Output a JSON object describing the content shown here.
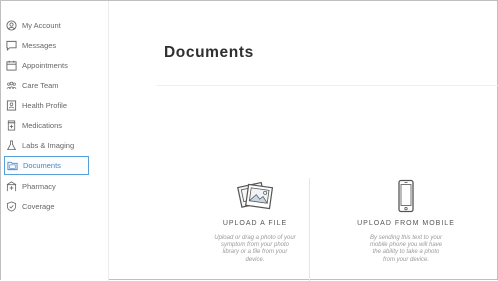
{
  "sidebar": {
    "items": [
      {
        "label": "My Account",
        "icon": "account-circle-icon"
      },
      {
        "label": "Messages",
        "icon": "message-icon"
      },
      {
        "label": "Appointments",
        "icon": "calendar-icon"
      },
      {
        "label": "Care Team",
        "icon": "team-icon"
      },
      {
        "label": "Health Profile",
        "icon": "profile-card-icon"
      },
      {
        "label": "Medications",
        "icon": "pill-bottle-icon"
      },
      {
        "label": "Labs & Imaging",
        "icon": "flask-icon"
      },
      {
        "label": "Documents",
        "icon": "folder-icon",
        "active": true
      },
      {
        "label": "Pharmacy",
        "icon": "pharmacy-icon"
      },
      {
        "label": "Coverage",
        "icon": "shield-icon"
      }
    ]
  },
  "main": {
    "title": "Documents"
  },
  "upload_file": {
    "title": "UPLOAD A FILE",
    "description": "Upload or drag a photo of your symptom from your photo library or a file from your device.",
    "icon": "photos-icon"
  },
  "upload_mobile": {
    "title": "UPLOAD FROM MOBILE",
    "description": "By sending this text to your mobile phone you will have the ability to take a photo from your device.",
    "icon": "phone-icon"
  },
  "colors": {
    "accent": "#4a86c6",
    "active_border": "#5aa0d8",
    "text": "#333333",
    "muted": "#9a9a9a"
  }
}
